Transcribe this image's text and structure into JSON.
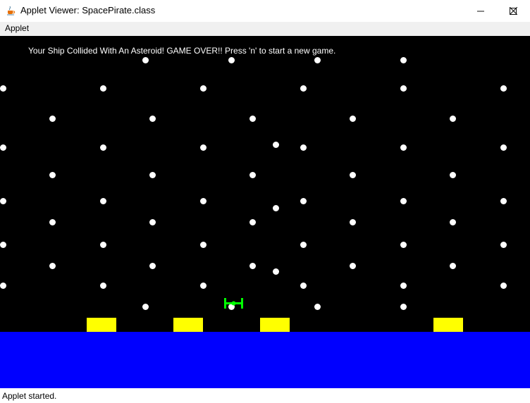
{
  "window": {
    "title": "Applet Viewer: SpacePirate.class",
    "icon": "java-cup-icon",
    "controls": [
      "minimize-icon",
      "maximize-icon",
      "close-icon"
    ]
  },
  "menu": {
    "items": [
      {
        "label": "Applet"
      }
    ]
  },
  "game": {
    "message": "Your Ship Collided With An Asteroid! GAME OVER!! Press 'n' to start a new game.",
    "colors": {
      "background": "#000000",
      "stars": "#ffffff",
      "ground": "#0000ff",
      "blocks": "#ffff00",
      "ship": "#00ff00"
    }
  },
  "status": {
    "text": "Applet started."
  }
}
